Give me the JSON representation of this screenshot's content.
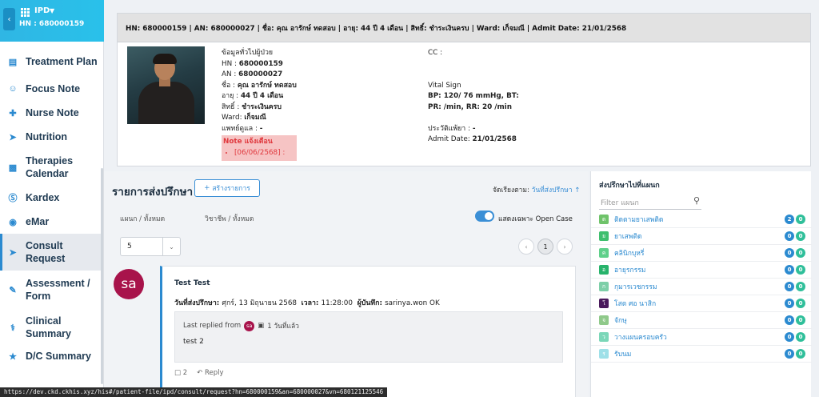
{
  "sidebar": {
    "module": "IPD",
    "hn_label": "HN : 680000159",
    "items": [
      {
        "label": "Treatment Plan",
        "icon": "clipboard-icon"
      },
      {
        "label": "Focus Note",
        "icon": "people-icon"
      },
      {
        "label": "Nurse Note",
        "icon": "medical-kit-icon"
      },
      {
        "label": "Nutrition",
        "icon": "fish-icon"
      },
      {
        "label": "Therapies Calendar",
        "icon": "treatment-icon"
      },
      {
        "label": "Kardex",
        "icon": "k-circle-icon"
      },
      {
        "label": "eMar",
        "icon": "pills-icon"
      },
      {
        "label": "Consult Request",
        "icon": "send-icon"
      },
      {
        "label": "Assessment / Form",
        "icon": "form-icon"
      },
      {
        "label": "Clinical Summary",
        "icon": "doctor-icon"
      },
      {
        "label": "D/C Summary",
        "icon": "trophy-icon"
      }
    ]
  },
  "status_url": "https://dev.ckd.ckhis.xyz/his#/patient-file/ipd/consult/request?hn=680000159&an=680000027&vn=680121125546",
  "patient": {
    "header": "HN: 680000159 | AN: 680000027 | ชื่อ: คุณ อารักษ์ ทดสอบ | อายุ: 44 ปี 4 เดือน | สิทธิ์: ชำระเงินครบ | Ward: เก็จมณี | Admit Date: 21/01/2568",
    "general_title": "ข้อมูลทั่วไปผู้ป่วย",
    "hn_label": "HN : ",
    "hn": "680000159",
    "an_label": "AN : ",
    "an": "680000027",
    "name_label": "ชื่อ : ",
    "name": "คุณ อารักษ์ ทดสอบ",
    "age_label": "อายุ : ",
    "age": "44 ปี 4 เดือน",
    "right_label": "สิทธิ์ : ",
    "right": "ชำระเงินครบ",
    "ward_label": "Ward: ",
    "ward": "เก็จมณี",
    "doctor_label": "แพทย์ดูแล : ",
    "doctor": "-",
    "note_title": "Note แจ้งเตือน",
    "note_item": "[06/06/2568] :",
    "cc_label": "CC :",
    "vital_label": "Vital Sign",
    "bp_line": "BP: 120/ 76 mmHg, BT:",
    "pr_line": "PR:  /min, RR: 20 /min",
    "allergy_label": "ประวัติแพ้ยา : ",
    "allergy": "-",
    "admit_label": "Admit Date: ",
    "admit_date": "21/01/2568"
  },
  "consult": {
    "title": "รายการส่งปรึกษา",
    "create_btn": "สร้างรายการ",
    "sort_label": "จัดเรียงตาม: ",
    "sort_value": "วันที่ส่งปรึกษา",
    "dept_filter": "แผนก  /  ทั้งหมด",
    "prof_filter": "วิชาชีพ  /  ทั้งหมด",
    "open_only_label": "แสดงเฉพาะ Open Case",
    "page_size": "5",
    "page": "1",
    "item": {
      "avatar": "sa",
      "title": "Test Test",
      "date_label": "วันที่ส่งปรึกษา: ",
      "date": "ศุกร์, 13 มิถุนายน 2568",
      "time_label": "เวลา: ",
      "time": "11:28:00",
      "recorder_label": "ผู้บันทึก: ",
      "recorder": "sarinya.won OK",
      "last_replied_label": "Last replied from",
      "reply_avatar": "sa",
      "reply_ago": "1 วันที่แล้ว",
      "reply_text": "test 2",
      "comment_count": "2",
      "reply_btn": "Reply"
    }
  },
  "departments": {
    "title": "ส่งปรึกษาไปที่แผนก",
    "filter_placeholder": "Filter แผนก",
    "items": [
      {
        "letter": "ต",
        "name": "ติดตามยาเสพติด",
        "a": "2",
        "b": "0",
        "color": "#6fc36a"
      },
      {
        "letter": "ย",
        "name": "ยาเสพติด",
        "a": "0",
        "b": "0",
        "color": "#3fbf6e"
      },
      {
        "letter": "ค",
        "name": "คลินิกบุหรี่",
        "a": "0",
        "b": "0",
        "color": "#5fd08a"
      },
      {
        "letter": "อ",
        "name": "อายุรกรรม",
        "a": "0",
        "b": "0",
        "color": "#27b36b"
      },
      {
        "letter": "ก",
        "name": "กุมารเวชกรรม",
        "a": "0",
        "b": "0",
        "color": "#7dcfa8"
      },
      {
        "letter": "โ",
        "name": "โสต ศอ นาสิก",
        "a": "0",
        "b": "0",
        "color": "#4a1a5c"
      },
      {
        "letter": "จ",
        "name": "จักษุ",
        "a": "0",
        "b": "0",
        "color": "#8fc98a"
      },
      {
        "letter": "ว",
        "name": "วางแผนครอบครัว",
        "a": "0",
        "b": "0",
        "color": "#7bd7b8"
      },
      {
        "letter": "ร",
        "name": "รับนม",
        "a": "0",
        "b": "0",
        "color": "#9ee0e8"
      }
    ]
  }
}
